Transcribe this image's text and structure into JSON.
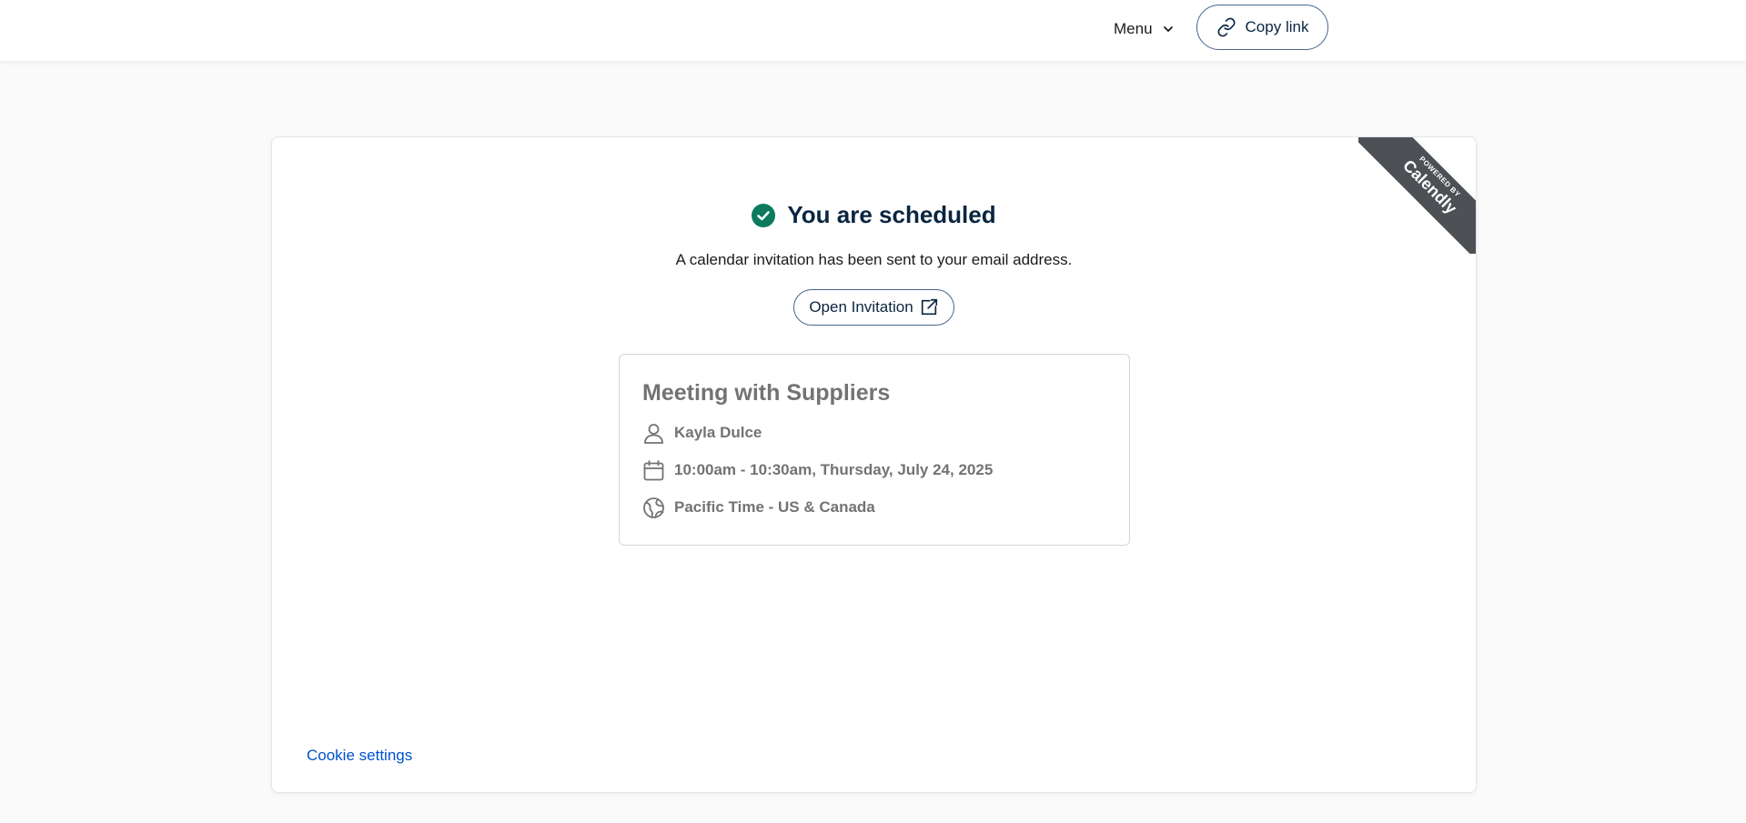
{
  "header": {
    "menu_label": "Menu",
    "copy_link_label": "Copy link"
  },
  "badge": {
    "powered_by": "POWERED BY",
    "brand": "Calendly"
  },
  "confirmation": {
    "title": "You are scheduled",
    "subtitle": "A calendar invitation has been sent to your email address.",
    "open_invitation_label": "Open Invitation"
  },
  "event": {
    "name": "Meeting with Suppliers",
    "host": "Kayla Dulce",
    "datetime": "10:00am - 10:30am, Thursday, July 24, 2025",
    "timezone": "Pacific Time - US & Canada"
  },
  "footer": {
    "cookie_settings_label": "Cookie settings"
  },
  "colors": {
    "success": "#0b7a5e",
    "text_primary": "#0a2540",
    "text_muted": "#737373",
    "link": "#0052cc",
    "button_border": "#476788",
    "ribbon": "#4d5156"
  },
  "icons": {
    "menu": "chevron-down-icon",
    "copy_link": "link-icon",
    "title": "check-circle-icon",
    "open_invitation": "external-link-icon",
    "host": "person-icon",
    "datetime": "calendar-icon",
    "timezone": "globe-icon"
  }
}
